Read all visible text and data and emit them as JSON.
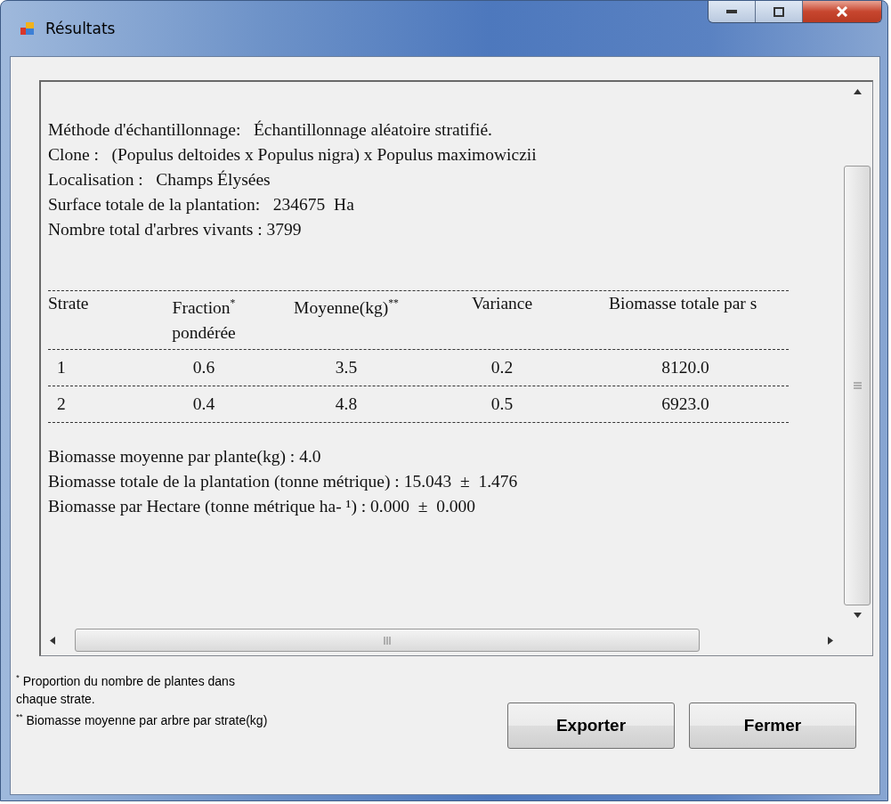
{
  "window": {
    "title": "Résultats"
  },
  "report": {
    "info_lines": [
      "Méthode d'échantillonnage:   Échantillonnage aléatoire stratifié.",
      "Clone :   (Populus deltoides x Populus nigra) x Populus maximowiczii",
      "Localisation :   Champs Élysées",
      "Surface totale de la plantation:   234675  Ha",
      "Nombre total d'arbres vivants : 3799"
    ],
    "table": {
      "columns": [
        "Strate",
        "Fraction$^{*}$\npondérée",
        "Moyenne(kg)$^{**}$",
        "Variance",
        "Biomasse totale par s"
      ],
      "rows": [
        [
          "1",
          "0.6",
          "3.5",
          "0.2",
          "8120.0"
        ],
        [
          "2",
          "0.4",
          "4.8",
          "0.5",
          "6923.0"
        ]
      ]
    },
    "summary_lines": [
      "Biomasse moyenne par plante(kg) : 4.0",
      "Biomasse totale de la plantation (tonne métrique) : 15.043  ±  1.476",
      "Biomasse par Hectare (tonne métrique ha- ¹) : 0.000  ±  0.000"
    ]
  },
  "footnotes": [
    "$^{*}$ Proportion du nombre de plantes dans chaque strate.",
    "$^{**}$ Biomasse moyenne par arbre par strate(kg)"
  ],
  "buttons": [
    "Exporter",
    "Fermer"
  ]
}
